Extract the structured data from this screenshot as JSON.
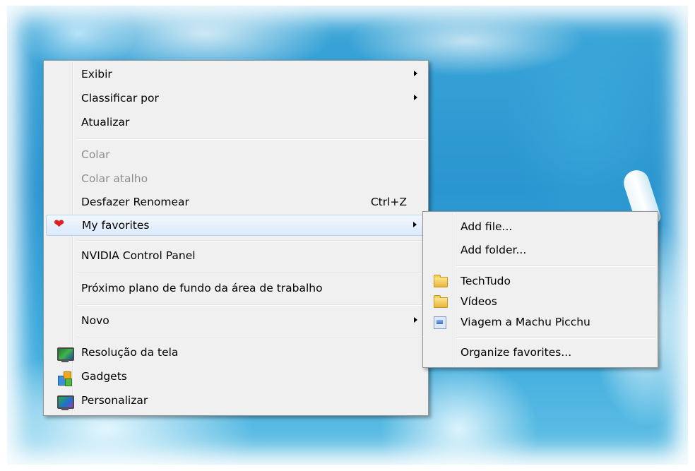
{
  "context_menu": {
    "items": [
      {
        "label": "Exibir",
        "submenu": true
      },
      {
        "label": "Classificar por",
        "submenu": true
      },
      {
        "label": "Atualizar"
      },
      {
        "label": "Colar",
        "disabled": true
      },
      {
        "label": "Colar atalho",
        "disabled": true
      },
      {
        "label": "Desfazer Renomear",
        "shortcut": "Ctrl+Z"
      },
      {
        "label": "My favorites",
        "submenu": true,
        "icon": "heart-icon",
        "highlighted": true
      },
      {
        "label": "NVIDIA Control Panel"
      },
      {
        "label": "Próximo plano de fundo da área de trabalho"
      },
      {
        "label": "Novo",
        "submenu": true
      },
      {
        "label": "Resolução da tela",
        "icon": "monitor-icon"
      },
      {
        "label": "Gadgets",
        "icon": "gadgets-icon"
      },
      {
        "label": "Personalizar",
        "icon": "personalize-icon"
      }
    ]
  },
  "favorites_submenu": {
    "items": [
      {
        "label": "Add file..."
      },
      {
        "label": "Add folder..."
      },
      {
        "label": "TechTudo",
        "icon": "folder-icon"
      },
      {
        "label": "Vídeos",
        "icon": "folder-icon"
      },
      {
        "label": "Viagem a Machu Picchu",
        "icon": "photo-file-icon"
      },
      {
        "label": "Organize favorites..."
      }
    ]
  },
  "colors": {
    "menu_background": "#f0f0f0",
    "menu_border": "#979797",
    "highlight": "#dbeafb",
    "disabled_text": "#8d8d8d",
    "heart": "#e02020"
  }
}
